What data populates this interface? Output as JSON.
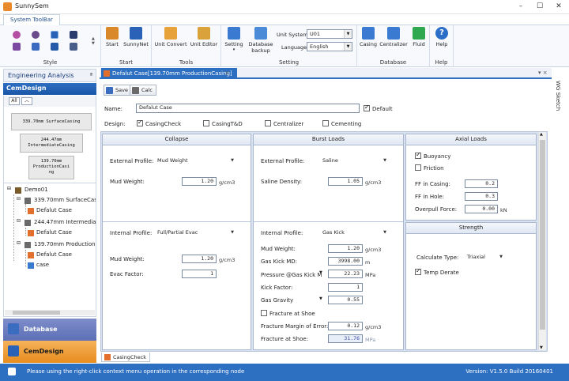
{
  "app": {
    "title": "SunnySem"
  },
  "ribbon": {
    "tab": "System ToolBar",
    "groups": {
      "style": "Style",
      "start": "Start",
      "tools": "Tools",
      "setting": "Setting",
      "database": "Database",
      "help": "Help"
    },
    "buttons": {
      "start": "Start",
      "sunnynet": "SunnyNet",
      "unit_convert": "Unit Convert",
      "unit_editor": "Unit Editor",
      "setting": "Setting",
      "database_backup_1": "Database",
      "database_backup_2": "backup",
      "casing": "Casing",
      "centralizer": "Centralizer",
      "fluid": "Fluid",
      "help": "Help"
    },
    "unit_system_label": "Unit System",
    "unit_system_value": "U01",
    "language_label": "Language",
    "language_value": "English"
  },
  "left": {
    "header": "Engineering Analysis",
    "pin": "ª",
    "module": "CemDesign",
    "all_btn": "All",
    "up_btn": "︿",
    "casing_boxes": {
      "c1": "339.70mm SurfaceCasing",
      "c2a": "244.47mm",
      "c2b": "IntermediateCasing",
      "c3a": "139.70mm",
      "c3b": "ProductionCasi",
      "c3c": "ng"
    },
    "tree": {
      "root": "Demo01",
      "n1": "339.70mm SurfaceCasi",
      "n1c": "Defalut Case",
      "n2": "244.47mm Intermediate",
      "n2c": "Defalut Case",
      "n3": "139.70mm ProductionC",
      "n3c": "Defalut Case",
      "n3c2": "case"
    },
    "nav": {
      "database": "Database",
      "cemdesign": "CemDesign"
    }
  },
  "doc": {
    "tab": "Defalut Case[139.70mm ProductionCasing]",
    "close": "×",
    "pin": "▾ ×",
    "side_tab": "WG Sketch",
    "save": "Save",
    "calc": "Calc",
    "name_label": "Name:",
    "name_value": "Defalut Case",
    "default_label": "Default",
    "design_label": "Design:",
    "design_options": {
      "casingcheck": "CasingCheck",
      "casingtd": "CasingT&D",
      "centralizer": "Centralizer",
      "cementing": "Cementing"
    },
    "bottom_tab": "CasingCheck"
  },
  "collapse": {
    "title": "Collapse",
    "ext_profile_label": "External Profile:",
    "ext_profile_value": "Mud Weight",
    "mud_weight_label": "Mud Weight:",
    "mud_weight_value": "1.20",
    "mud_weight_unit": "g/cm3",
    "int_profile_label": "Internal Profile:",
    "int_profile_value": "Full/Partial Evac",
    "int_mud_label": "Mud Weight:",
    "int_mud_value": "1.20",
    "int_mud_unit": "g/cm3",
    "evac_label": "Evac Factor:",
    "evac_value": "1"
  },
  "burst": {
    "title": "Burst Loads",
    "ext_profile_label": "External Profile:",
    "ext_profile_value": "Saline",
    "saline_label": "Saline Density:",
    "saline_value": "1.05",
    "saline_unit": "g/cm3",
    "int_profile_label": "Internal Profile:",
    "int_profile_value": "Gas Kick",
    "mud_label": "Mud Weight:",
    "mud_value": "1.20",
    "mud_unit": "g/cm3",
    "kickmd_label": "Gas Kick MD:",
    "kickmd_value": "3998.00",
    "kickmd_unit": "m",
    "pressure_label": "Pressure @Gas Kick M",
    "pressure_value": "22.23",
    "pressure_unit": "MPa",
    "kickfactor_label": "Kick Factor:",
    "kickfactor_value": "1",
    "gasgravity_label": "Gas Gravity",
    "gasgravity_value": "0.55",
    "fracture_label": "Fracture at Shoe",
    "margin_label": "Fracture Margin of Error:",
    "margin_value": "0.12",
    "margin_unit": "g/cm3",
    "shoe_label": "Fracture at Shoe:",
    "shoe_value": "31.76",
    "shoe_unit": "MPa"
  },
  "axial": {
    "title": "Axial Loads",
    "buoyancy_label": "Buoyancy",
    "friction_label": "Friction",
    "ff_casing_label": "FF in Casing:",
    "ff_casing_value": "0.2",
    "ff_hole_label": "FF in Hole:",
    "ff_hole_value": "0.3",
    "overpull_label": "Overpull Force:",
    "overpull_value": "0.00",
    "overpull_unit": "kN"
  },
  "strength": {
    "title": "Strength",
    "calc_type_label": "Calculate Type:",
    "calc_type_value": "Triaxial",
    "temp_derate_label": "Temp Derate"
  },
  "status": {
    "message": "Please using the right-click context menu operation in the corresponding node",
    "version": "Version:  V1.5.0 Build 20160401"
  },
  "colors": {
    "accent": "#2d6fc1",
    "orange": "#e88c1e",
    "db_nav": "#6a7bbf"
  }
}
